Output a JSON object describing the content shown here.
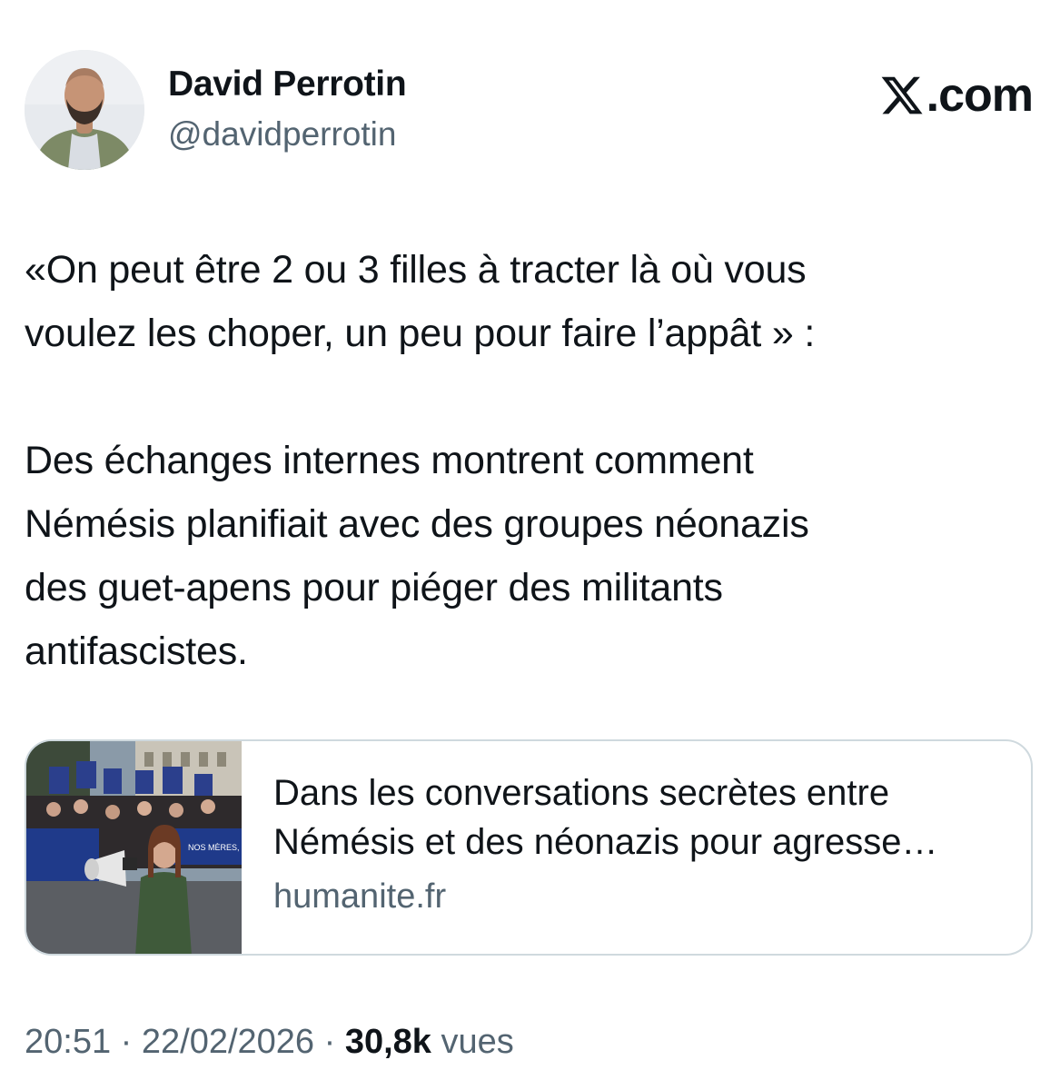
{
  "author": {
    "name": "David Perrotin",
    "handle": "@davidperrotin",
    "avatar_icon": "profile-photo"
  },
  "brand": {
    "icon": "x-logo-icon",
    "domain_suffix": ".com"
  },
  "tweet": {
    "paragraph_1_line_1": "«On peut être 2 ou 3 filles à tracter là où vous",
    "paragraph_1_line_2": "voulez les choper, un peu pour faire l’appât » :",
    "paragraph_2_line_1": "Des échanges internes montrent comment",
    "paragraph_2_line_2": "Némésis planifiait avec des groupes néonazis",
    "paragraph_2_line_3": "des guet-apens pour piéger des militants",
    "paragraph_2_line_4": "antifascistes."
  },
  "link_card": {
    "title_line_1": "Dans les conversations secrètes entre",
    "title_line_2": "Némésis et des néonazis pour agresse…",
    "domain": "humanite.fr",
    "image_icon": "article-photo",
    "image_banner_text": "NOS MÈRES, N"
  },
  "meta": {
    "time": "20:51",
    "separator": "·",
    "date": "22/02/2026",
    "views_count": "30,8k",
    "views_label": "vues"
  },
  "colors": {
    "text_primary": "#0f1419",
    "text_secondary": "#536471",
    "card_border": "#cfd9de",
    "background": "#ffffff"
  }
}
